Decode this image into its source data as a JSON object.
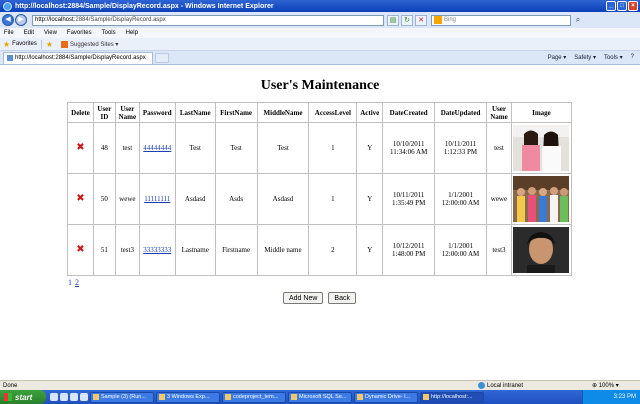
{
  "window": {
    "title": "http://localhost:2884/Sample/DisplayRecord.aspx - Windows Internet Explorer"
  },
  "address": {
    "host": "http://localhost",
    "rest": ":2884/Sample/DisplayRecord.aspx",
    "search_placeholder": "Bing"
  },
  "menu": [
    "File",
    "Edit",
    "View",
    "Favorites",
    "Tools",
    "Help"
  ],
  "favorites": {
    "label": "Favorites",
    "suggested": "Suggested Sites ▾"
  },
  "tab": {
    "label": "http://localhost:2884/Sample/DisplayRecord.aspx"
  },
  "commands": [
    "Page ▾",
    "Safety ▾",
    "Tools ▾",
    "?"
  ],
  "page": {
    "title": "User's Maintenance",
    "headers": [
      "Delete",
      "User ID",
      "User Name",
      "Password",
      "LastName",
      "FirstName",
      "MiddleName",
      "AccessLevel",
      "Active",
      "DateCreated",
      "DateUpdated",
      "User Name",
      "Image"
    ],
    "rows": [
      {
        "id": "48",
        "username": "test",
        "password": "44444444",
        "last": "Test",
        "first": "Test",
        "middle": "Test",
        "access": "1",
        "active": "Y",
        "created": "10/10/2011 11:34:06 AM",
        "updated": "10/11/2011 1:12:33 PM",
        "username2": "test"
      },
      {
        "id": "50",
        "username": "wewe",
        "password": "11111111",
        "last": "Asdasd",
        "first": "Asds",
        "middle": "Asdasd",
        "access": "1",
        "active": "Y",
        "created": "10/11/2011 1:35:49 PM",
        "updated": "1/1/2001 12:00:00 AM",
        "username2": "wewe"
      },
      {
        "id": "51",
        "username": "test3",
        "password": "33333333",
        "last": "Lastname",
        "first": "Firstname",
        "middle": "Middle name",
        "access": "2",
        "active": "Y",
        "created": "10/12/2011 1:48:00 PM",
        "updated": "1/1/2001 12:00:00 AM",
        "username2": "test3"
      }
    ],
    "pager": [
      "1",
      "2"
    ],
    "add_button": "Add New",
    "back_button": "Back"
  },
  "status": {
    "left": "Done",
    "zone": "Local intranet",
    "zoom": "⊕ 100% ▾"
  },
  "taskbar": {
    "start": "start",
    "tasks": [
      "Sample (3) (Run...",
      "3 Windows Exp...",
      "codeproject_tem...",
      "Microsoft SQL Se...",
      "Dynamic Drive- I...",
      "http://localhost:..."
    ],
    "clock": "3:23 PM"
  },
  "colors": {
    "titlebar": "#0a3fb8",
    "link": "#1a3fb0",
    "delete": "#cc1a1a"
  }
}
